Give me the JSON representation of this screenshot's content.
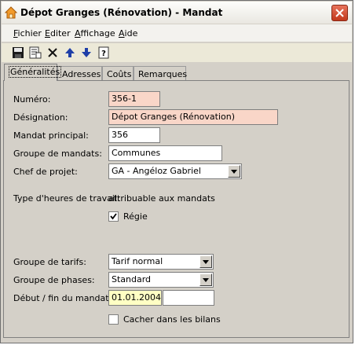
{
  "window": {
    "title": "Dépot Granges (Rénovation) - Mandat",
    "icon": "house-icon",
    "close_icon": "close-icon"
  },
  "menu": [
    {
      "label": "Fichier",
      "accel": "F"
    },
    {
      "label": "Editer",
      "accel": "E"
    },
    {
      "label": "Affichage",
      "accel": "A"
    },
    {
      "label": "Aide",
      "accel": "A"
    }
  ],
  "toolbar": {
    "icons": [
      "save-icon",
      "properties-icon",
      "delete-icon",
      "arrow-up-icon",
      "arrow-down-icon",
      "help-icon"
    ]
  },
  "tabs": [
    {
      "label": "Généralités",
      "active": true
    },
    {
      "label": "Adresses",
      "active": false
    },
    {
      "label": "Coûts",
      "active": false
    },
    {
      "label": "Remarques",
      "active": false
    }
  ],
  "form": {
    "numero": {
      "label": "Numéro:",
      "value": "356-1"
    },
    "designation": {
      "label": "Désignation:",
      "value": "Dépot Granges (Rénovation)"
    },
    "mandat_principal": {
      "label": "Mandat principal:",
      "value": "356"
    },
    "groupe_mandats": {
      "label": "Groupe de mandats:",
      "value": "Communes"
    },
    "chef_projet": {
      "label": "Chef de projet:",
      "value": "GA - Angéloz Gabriel"
    },
    "type_heures": {
      "label": "Type d'heures de travail:",
      "value": "attribuable aux mandats"
    },
    "regie": {
      "label": "Régie",
      "checked": true
    },
    "groupe_tarifs": {
      "label": "Groupe de tarifs:",
      "value": "Tarif normal"
    },
    "groupe_phases": {
      "label": "Groupe de phases:",
      "value": "Standard"
    },
    "debut_fin": {
      "label": "Début / fin du mandat:",
      "start": "01.01.2004",
      "end": ""
    },
    "cacher_bilans": {
      "label": "Cacher dans les bilans",
      "checked": false
    }
  },
  "colors": {
    "required_field": "#f9d6c8",
    "date_field": "#ffffc4",
    "close_button": "#c2381c"
  }
}
